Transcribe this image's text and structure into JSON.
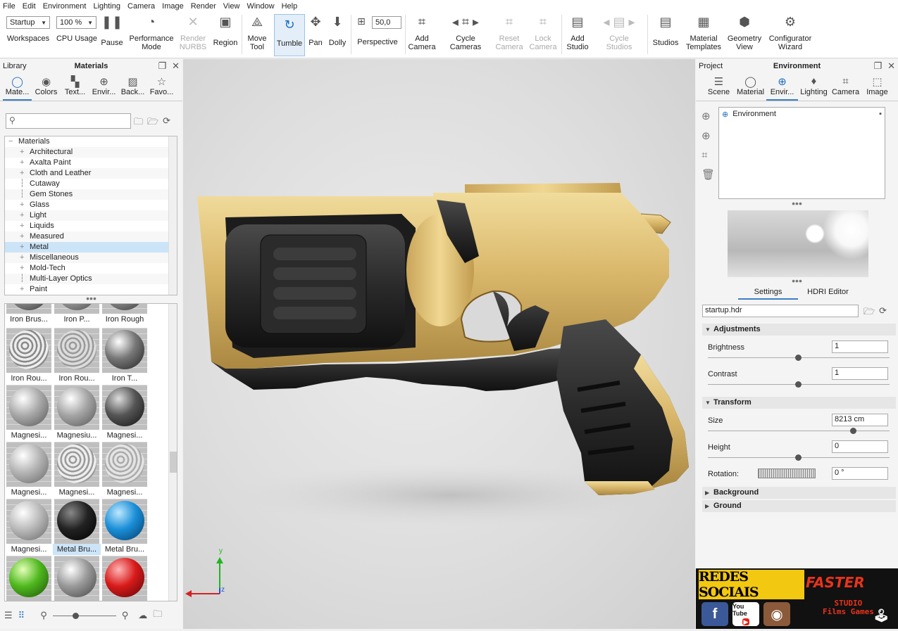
{
  "menu": [
    "File",
    "Edit",
    "Environment",
    "Lighting",
    "Camera",
    "Image",
    "Render",
    "View",
    "Window",
    "Help"
  ],
  "toolbar": {
    "workspace_value": "Startup",
    "workspaces_label": "Workspaces",
    "cpu_value": "100 %",
    "cpu_label": "CPU Usage",
    "pause_label": "Pause",
    "performance_label_1": "Performance",
    "performance_label_2": "Mode",
    "render_nurbs_1": "Render",
    "render_nurbs_2": "NURBS",
    "region_label": "Region",
    "move_tool_1": "Move",
    "move_tool_2": "Tool",
    "tumble_label": "Tumble",
    "pan_label": "Pan",
    "dolly_label": "Dolly",
    "fov_value": "50,0",
    "perspective_label": "Perspective",
    "add_camera_1": "Add",
    "add_camera_2": "Camera",
    "cycle_cameras_1": "Cycle",
    "cycle_cameras_2": "Cameras",
    "reset_camera_1": "Reset",
    "reset_camera_2": "Camera",
    "lock_camera_1": "Lock",
    "lock_camera_2": "Camera",
    "add_studio_1": "Add",
    "add_studio_2": "Studio",
    "cycle_studios_1": "Cycle",
    "cycle_studios_2": "Studios",
    "studios_label": "Studios",
    "material_templates_1": "Material",
    "material_templates_2": "Templates",
    "geometry_view_1": "Geometry",
    "geometry_view_2": "View",
    "configurator_1": "Configurator",
    "configurator_2": "Wizard"
  },
  "library": {
    "panel_label": "Library",
    "title": "Materials",
    "tabs": [
      "Mate...",
      "Colors",
      "Text...",
      "Envir...",
      "Back...",
      "Favo..."
    ],
    "tree_root": "Materials",
    "tree_items": [
      "Architectural",
      "Axalta Paint",
      "Cloth and Leather",
      "Cutaway",
      "Gem Stones",
      "Glass",
      "Light",
      "Liquids",
      "Measured",
      "Metal",
      "Miscellaneous",
      "Mold-Tech",
      "Multi-Layer Optics",
      "Paint"
    ],
    "selected_item": "Metal",
    "thumb_rows": [
      [
        "Iron Brus...",
        "Iron P...",
        "Iron Rough"
      ],
      [
        "Iron Rou...",
        "Iron Rou...",
        "Iron T..."
      ],
      [
        "Magnesi...",
        "Magnesiu...",
        "Magnesi..."
      ],
      [
        "Magnesi...",
        "Magnesi...",
        "Magnesi..."
      ],
      [
        "Magnesi...",
        "Metal Bru...",
        "Metal Bru..."
      ]
    ]
  },
  "project": {
    "panel_label": "Project",
    "title": "Environment",
    "tabs": [
      "Scene",
      "Material",
      "Envir...",
      "Lighting",
      "Camera",
      "Image"
    ],
    "env_item": "Environment",
    "subtabs": [
      "Settings",
      "HDRI Editor"
    ],
    "hdr_file": "startup.hdr",
    "adjustments_label": "Adjustments",
    "brightness_label": "Brightness",
    "brightness_value": "1",
    "contrast_label": "Contrast",
    "contrast_value": "1",
    "transform_label": "Transform",
    "size_label": "Size",
    "size_value": "8213 cm",
    "height_label": "Height",
    "height_value": "0",
    "rotation_label": "Rotation:",
    "rotation_value": "0 °",
    "background_label": "Background",
    "ground_label": "Ground"
  },
  "banner": {
    "redes": "REDES SOCIAIS",
    "brand": "FASTER",
    "brand_sub_1": "STUDIO",
    "brand_sub_2": "Films Games",
    "youtube": "You Tube"
  },
  "axes": {
    "y": "y",
    "z": "z"
  },
  "colors": {
    "accent": "#3b7fc4",
    "gold": "#d9b76a",
    "banner_yellow": "#f2c811"
  }
}
